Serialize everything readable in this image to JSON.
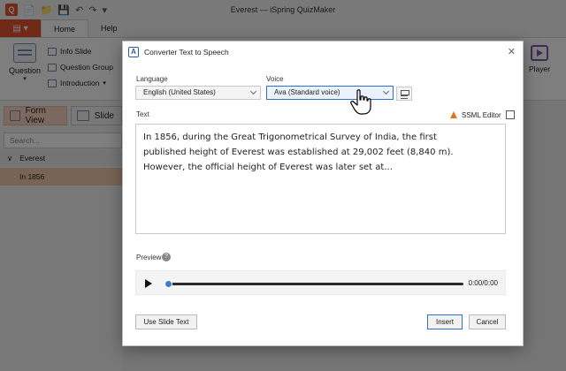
{
  "window": {
    "title": "Everest — iSpring QuizMaker"
  },
  "colors": {
    "accent": "#e0532f",
    "selection": "#f3c7ad",
    "focus": "#2f6fd0",
    "warning": "#e8731f"
  },
  "quick_access": {
    "icons": [
      "new-file-icon",
      "open-folder-icon",
      "save-icon",
      "undo-icon",
      "redo-icon",
      "customize-icon"
    ]
  },
  "ribbon": {
    "tabs": [
      "Home",
      "Help"
    ],
    "active_tab": "Home",
    "question_label": "Question",
    "items": [
      "Info Slide",
      "Question Group",
      "Introduction"
    ],
    "player_label": "Player"
  },
  "sidebar": {
    "form_view": "Form View",
    "slide_view": "Slide",
    "search_placeholder": "Search...",
    "tree_root": "Everest",
    "tree_child": "In 1856"
  },
  "dialog": {
    "title": "Converter Text to Speech",
    "language_label": "Language",
    "language_value": "English (United States)",
    "voice_label": "Voice",
    "voice_value": "Ava (Standard voice)",
    "text_label": "Text",
    "ssml_label": "SSML Editor",
    "text_content": "In 1856, during the Great Trigonometrical Survey of India, the first\npublished height of Everest was established at 29,002 feet (8,840 m).\nHowever, the official height of Everest was later set at...",
    "preview_label": "Preview",
    "time": "0:00/0:00",
    "progress": 0,
    "use_slide_text": "Use Slide Text",
    "insert": "Insert",
    "cancel": "Cancel"
  }
}
